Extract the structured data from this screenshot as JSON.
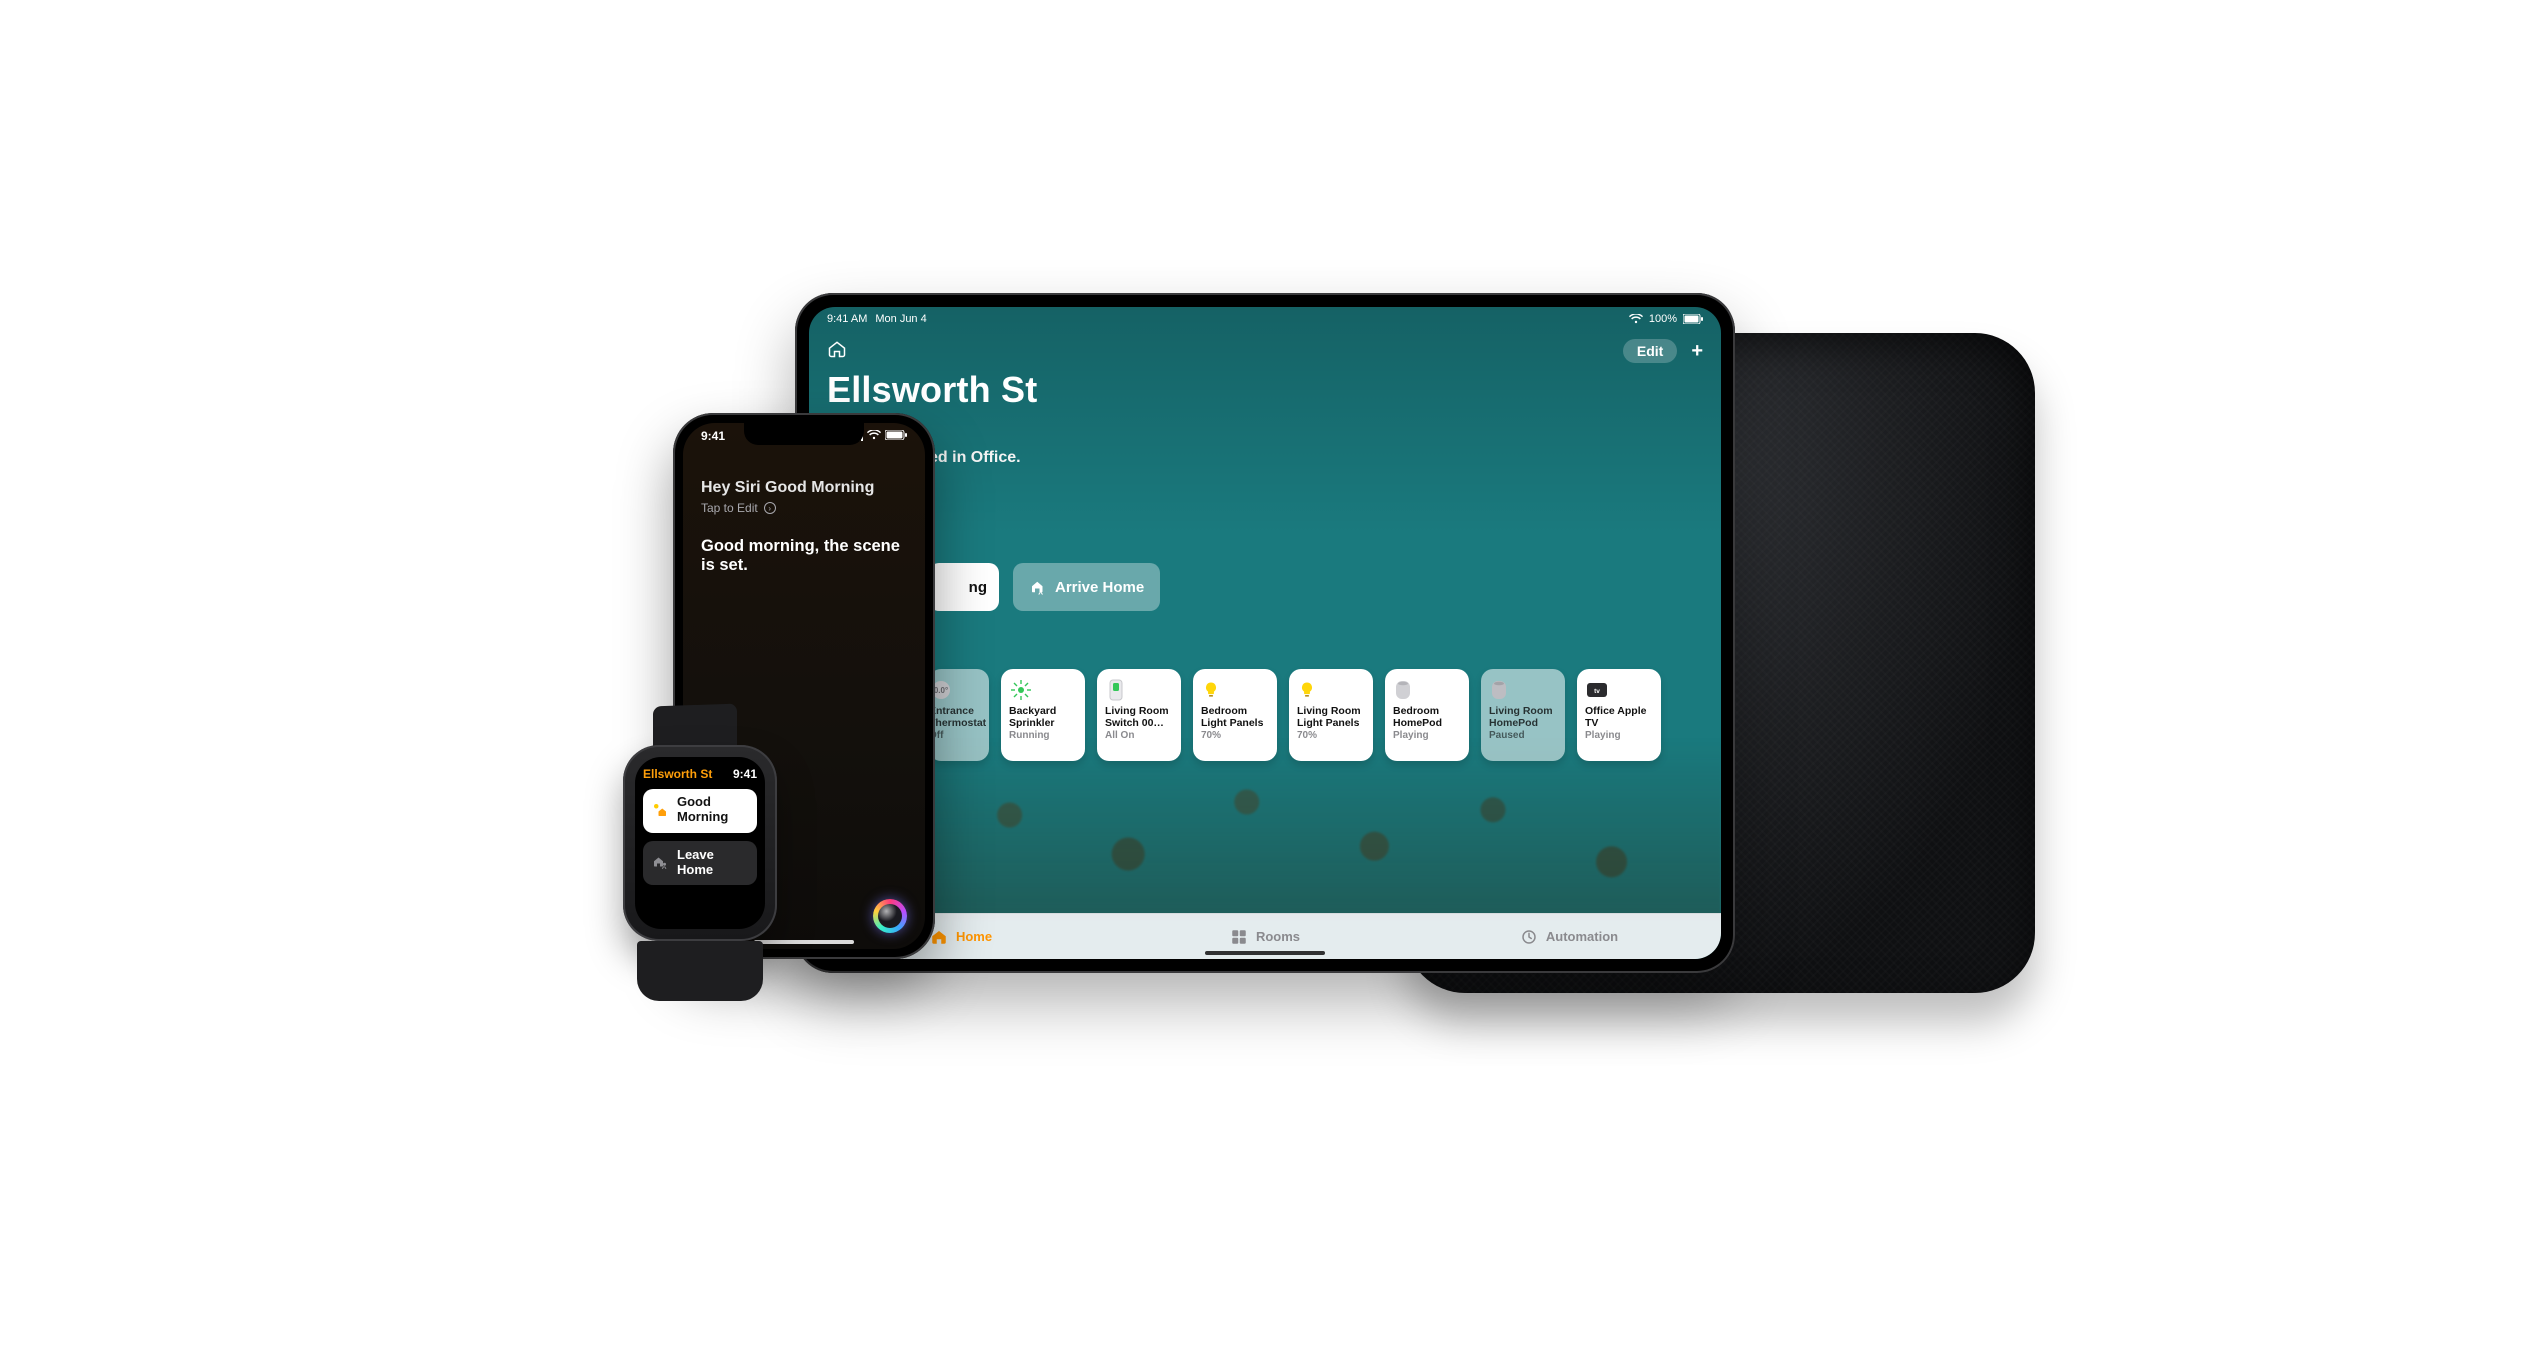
{
  "ipad": {
    "status": {
      "time": "9:41 AM",
      "date": "Mon Jun 4",
      "battery": "100%"
    },
    "edit_label": "Edit",
    "home_name": "Ellsworth St",
    "subtitle_partial": "ed in Office.",
    "scenes": [
      {
        "id": "good-morning",
        "label_partial": "ng",
        "active": true
      },
      {
        "id": "arrive-home",
        "label": "Arrive Home",
        "active": false
      }
    ],
    "tiles": [
      {
        "id": "entrance-thermostat",
        "name": "Entrance Thermostat",
        "sub": "Off",
        "style": "dim",
        "partial": true,
        "icon": "thermostat"
      },
      {
        "id": "backyard-sprinkler",
        "name": "Backyard Sprinkler",
        "sub": "Running",
        "style": "on",
        "icon": "sprinkler"
      },
      {
        "id": "lr-switch-00",
        "name": "Living Room Switch 00…",
        "sub": "All On",
        "style": "on",
        "icon": "switch"
      },
      {
        "id": "bedroom-light-panels",
        "name": "Bedroom Light Panels",
        "sub": "70%",
        "style": "on",
        "icon": "bulb"
      },
      {
        "id": "lr-light-panels",
        "name": "Living Room Light Panels",
        "sub": "70%",
        "style": "on",
        "icon": "bulb"
      },
      {
        "id": "bedroom-homepod",
        "name": "Bedroom HomePod",
        "sub": "Playing",
        "style": "on",
        "icon": "homepod"
      },
      {
        "id": "lr-homepod",
        "name": "Living Room HomePod",
        "sub": "Paused",
        "style": "dim",
        "icon": "homepod"
      },
      {
        "id": "office-apple-tv",
        "name": "Office Apple TV",
        "sub": "Playing",
        "style": "on",
        "icon": "appletv"
      }
    ],
    "tabs": {
      "home": "Home",
      "rooms": "Rooms",
      "automation": "Automation"
    }
  },
  "iphone": {
    "status_time": "9:41",
    "siri_prompt": "Hey Siri Good Morning",
    "tap_to_edit": "Tap to Edit",
    "siri_reply": "Good morning, the scene is set."
  },
  "watch": {
    "title": "Ellsworth St",
    "time": "9:41",
    "chips": [
      {
        "id": "good-morning",
        "label": "Good Morning",
        "active": true
      },
      {
        "id": "leave-home",
        "label": "Leave Home",
        "active": false
      }
    ]
  }
}
